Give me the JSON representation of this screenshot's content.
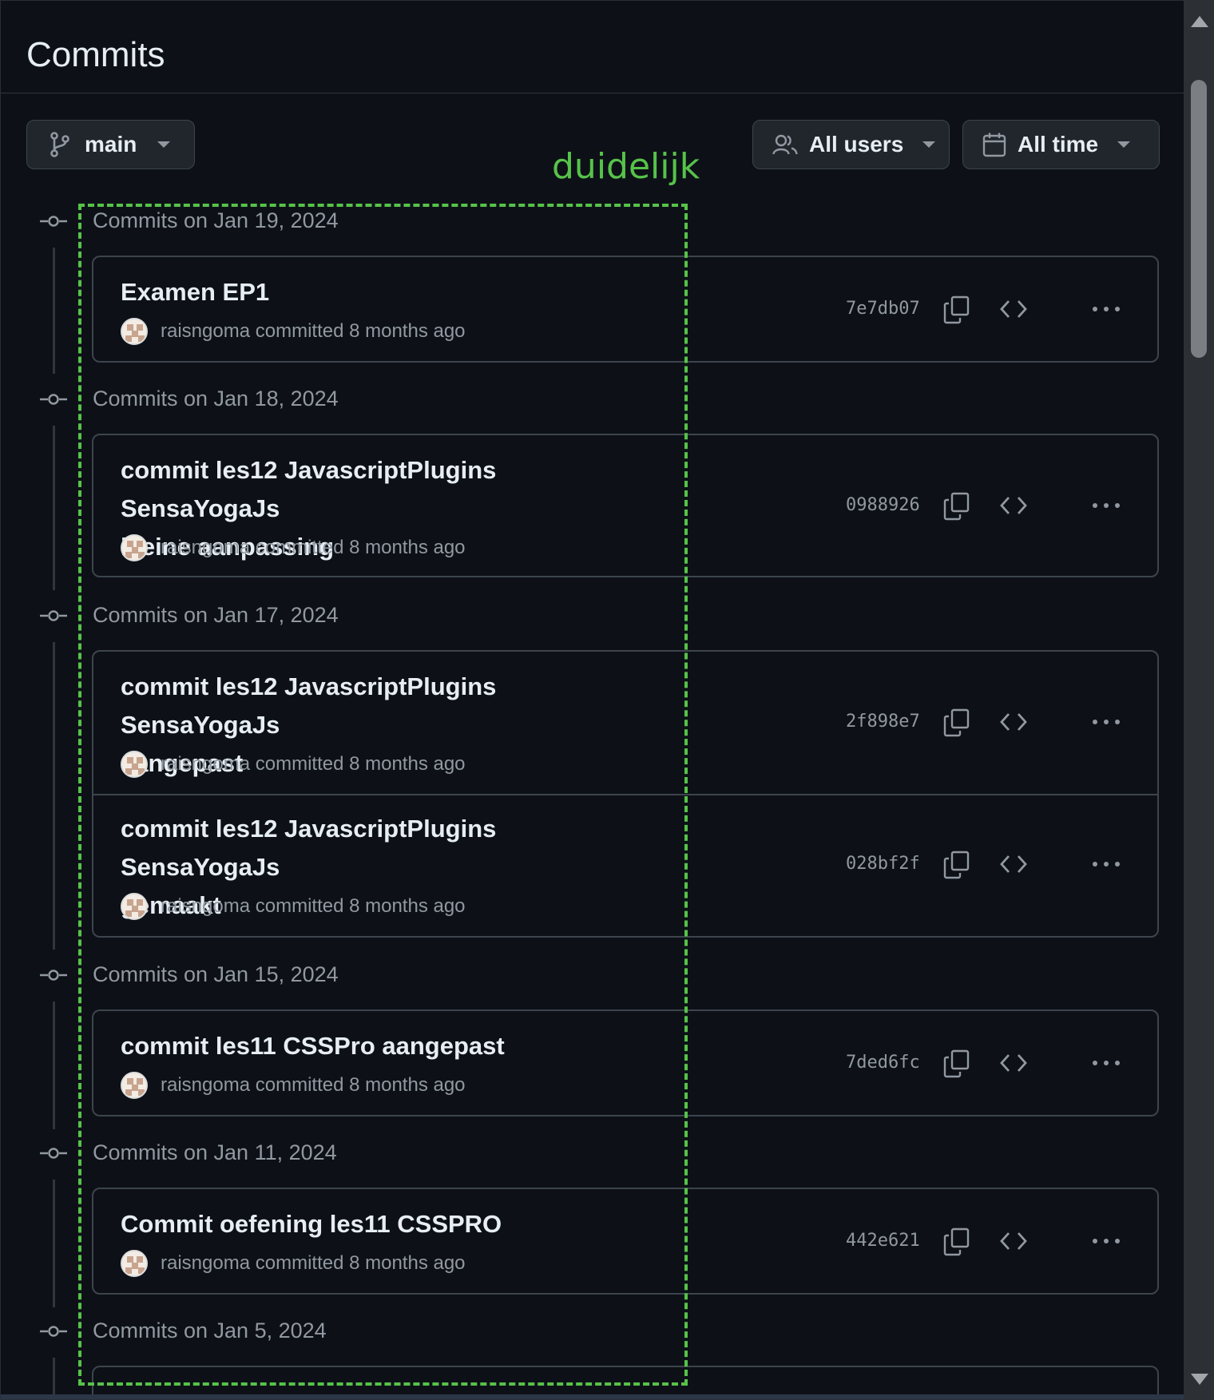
{
  "header": {
    "title": "Commits"
  },
  "filters": {
    "branch_label": "main",
    "users_label": "All users",
    "time_label": "All time"
  },
  "annotation": {
    "label": "duidelijk",
    "color": "#57c24a"
  },
  "groups": [
    {
      "date_label": "Commits on Jan 19, 2024",
      "commits": [
        {
          "title_lines": [
            "Examen EP1"
          ],
          "author": "raisngoma",
          "meta_suffix": "committed 8 months ago",
          "sha": "7e7db07"
        }
      ]
    },
    {
      "date_label": "Commits on Jan 18, 2024",
      "commits": [
        {
          "title_lines": [
            "commit les12 JavascriptPlugins SensaYogaJs",
            "kleine aanpassing"
          ],
          "author": "raisngoma",
          "meta_suffix": "committed 8 months ago",
          "sha": "0988926"
        }
      ]
    },
    {
      "date_label": "Commits on Jan 17, 2024",
      "commits": [
        {
          "title_lines": [
            "commit les12 JavascriptPlugins SensaYogaJs",
            "aangepast"
          ],
          "author": "raisngoma",
          "meta_suffix": "committed 8 months ago",
          "sha": "2f898e7"
        },
        {
          "title_lines": [
            "commit les12 JavascriptPlugins SensaYogaJs",
            "gemaakt"
          ],
          "author": "raisngoma",
          "meta_suffix": "committed 8 months ago",
          "sha": "028bf2f"
        }
      ]
    },
    {
      "date_label": "Commits on Jan 15, 2024",
      "commits": [
        {
          "title_lines": [
            "commit les11 CSSPro aangepast"
          ],
          "author": "raisngoma",
          "meta_suffix": "committed 8 months ago",
          "sha": "7ded6fc"
        }
      ]
    },
    {
      "date_label": "Commits on Jan 11, 2024",
      "commits": [
        {
          "title_lines": [
            "Commit oefening les11 CSSPRO"
          ],
          "author": "raisngoma",
          "meta_suffix": "committed 8 months ago",
          "sha": "442e621"
        }
      ]
    },
    {
      "date_label": "Commits on Jan 5, 2024",
      "commits": []
    }
  ],
  "icons": {
    "branch": "git-branch-icon",
    "users": "people-icon",
    "calendar": "calendar-icon",
    "copy": "copy-icon",
    "code": "code-icon",
    "more": "kebab-horizontal-icon",
    "commit_node": "git-commit-icon"
  }
}
